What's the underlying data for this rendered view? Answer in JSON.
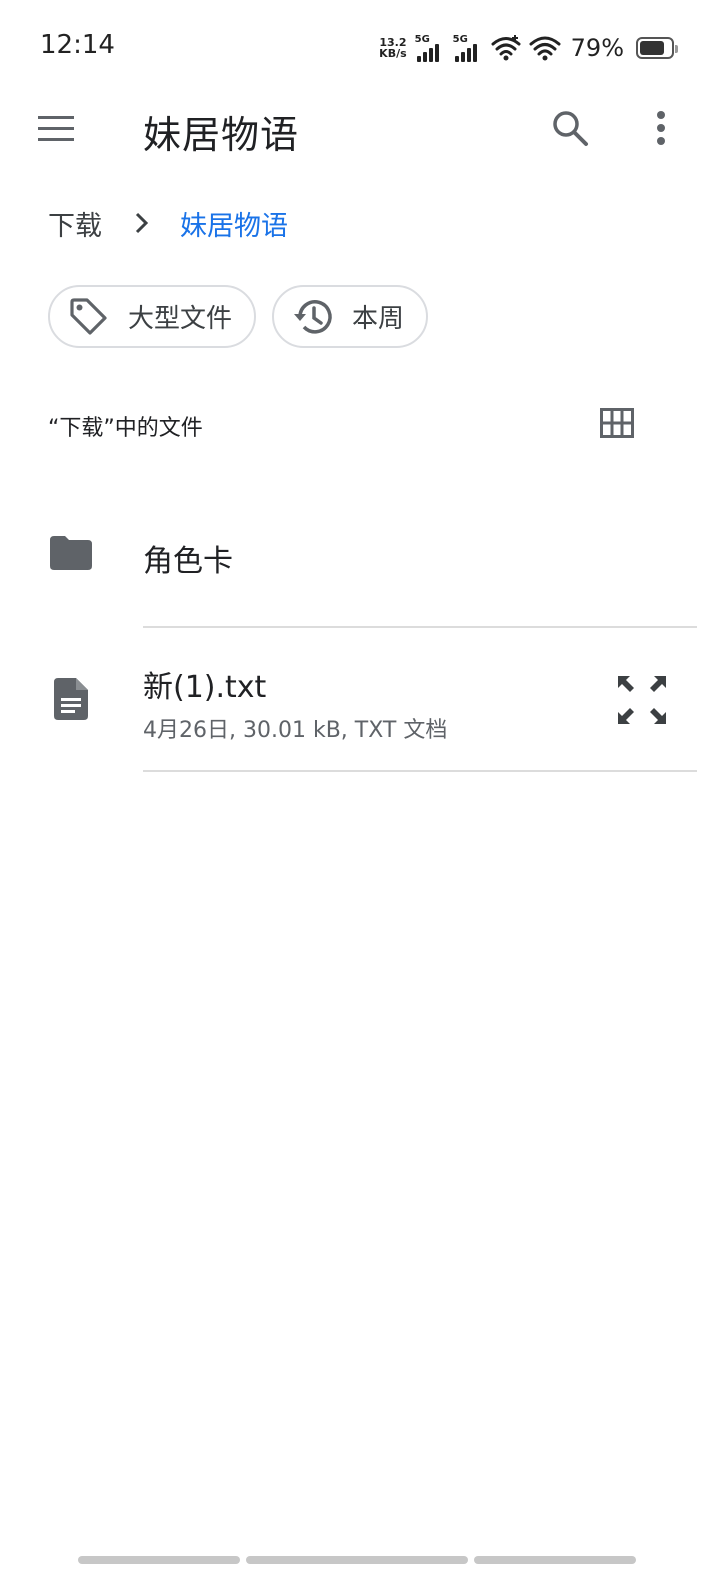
{
  "status_bar": {
    "time": "12:14",
    "net_speed_value": "13.2",
    "net_speed_unit": "KB/s",
    "sim1_label": "5G",
    "sim2_label": "5G",
    "battery_text": "79%",
    "battery_level": 0.79
  },
  "toolbar": {
    "title": "妹居物语",
    "menu_icon": "hamburger-menu-icon",
    "search_icon": "search-icon",
    "more_icon": "more-vert-icon"
  },
  "breadcrumb": {
    "root": "下载",
    "current": "妹居物语"
  },
  "chips": [
    {
      "label": "大型文件",
      "icon": "tag-icon"
    },
    {
      "label": "本周",
      "icon": "history-icon"
    }
  ],
  "list_header": {
    "label": "“下载”中的文件",
    "grid_icon": "grid-view-icon"
  },
  "files": [
    {
      "name": "角色卡",
      "type": "folder",
      "icon": "folder-icon"
    },
    {
      "name": "新(1).txt",
      "type": "file",
      "icon": "document-icon",
      "meta": "4月26日, 30.01 kB, TXT 文档",
      "action_icon": "expand-icon"
    }
  ],
  "colors": {
    "accent": "#1a73e8",
    "text_primary": "#202124",
    "text_secondary": "#5f6368",
    "icon": "#5f6368",
    "divider": "#dcdcdc"
  }
}
